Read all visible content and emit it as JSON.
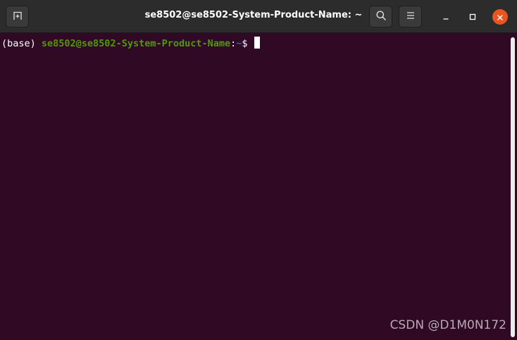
{
  "window": {
    "title": "se8502@se8502-System-Product-Name: ~",
    "icons": {
      "new_tab": "new-tab-icon",
      "search": "search-icon",
      "menu": "hamburger-menu-icon",
      "minimize": "minimize-icon",
      "maximize": "maximize-icon",
      "close": "close-icon"
    }
  },
  "terminal": {
    "env": "(base) ",
    "user_host": "se8502@se8502-System-Product-Name",
    "colon": ":",
    "cwd": "~",
    "prompt_char": "$ "
  },
  "colors": {
    "background": "#300a24",
    "titlebar": "#2c2c2c",
    "user_host": "#4e9a06",
    "cwd": "#3465a4",
    "close_button": "#e95420"
  },
  "watermark": "CSDN @D1M0N172"
}
